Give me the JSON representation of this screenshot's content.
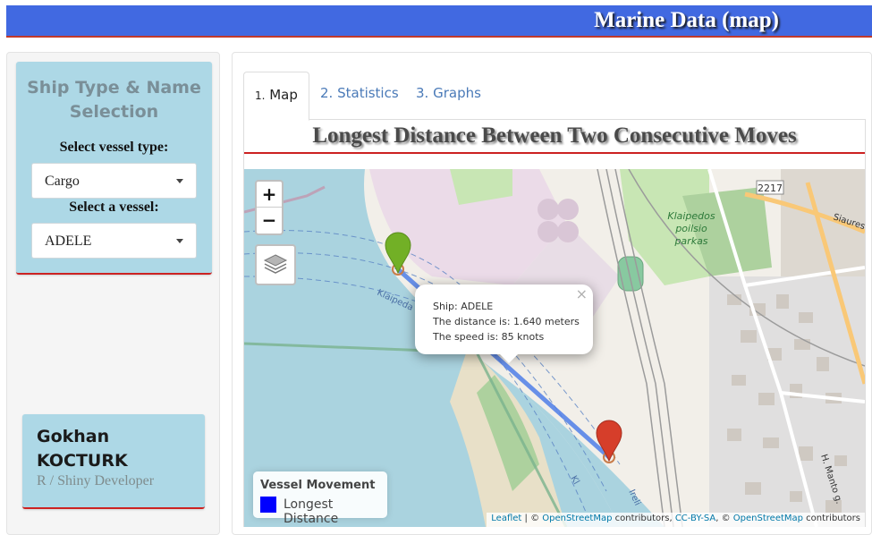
{
  "header": {
    "title": "Marine Data (map)",
    "accent": "#4169e1"
  },
  "sidebar": {
    "heading": "Ship Type & Name Selection",
    "vessel_type": {
      "label": "Select vessel type:",
      "value": "Cargo"
    },
    "vessel": {
      "label": "Select a vessel:",
      "value": "ADELE"
    },
    "author": {
      "name": "Gokhan KOCTURK",
      "role": "R / Shiny Developer"
    }
  },
  "tabs": [
    {
      "num": "1.",
      "label": "Map",
      "active": true
    },
    {
      "num": "2.",
      "label": "Statistics",
      "active": false
    },
    {
      "num": "3.",
      "label": "Graphs",
      "active": false
    }
  ],
  "main": {
    "heading": "Longest Distance Between Two Consecutive Moves"
  },
  "map": {
    "zoom_in": "+",
    "zoom_out": "−",
    "icons": {
      "layers": "layers-icon",
      "start_marker": "map-marker-green-icon",
      "end_marker": "map-marker-red-icon"
    },
    "popup": {
      "ship": "Ship: ADELE",
      "distance": "The distance is: 1.640 meters",
      "speed": "The speed is: 85 knots",
      "close": "×"
    },
    "legend": {
      "title": "Vessel Movement",
      "label": "Longest Distance",
      "color": "#0000ff"
    },
    "labels": {
      "park_line1": "Klaipedos",
      "park_line2": "poilsio",
      "park_line3": "parkas",
      "road_number": "2217",
      "street_1": "Siaures p",
      "street_2": "H. Manto g.",
      "water_1": "Klaipeda",
      "water_2": "Kl",
      "water_3": "Ireli"
    },
    "attribution": {
      "leaflet": "Leaflet",
      "sep": " | © ",
      "osm": "OpenStreetMap",
      "contrib": " contributors, ",
      "license": "CC-BY-SA",
      "sep2": ", © ",
      "osm2": "OpenStreetMap",
      "contrib2": " contributors"
    }
  }
}
